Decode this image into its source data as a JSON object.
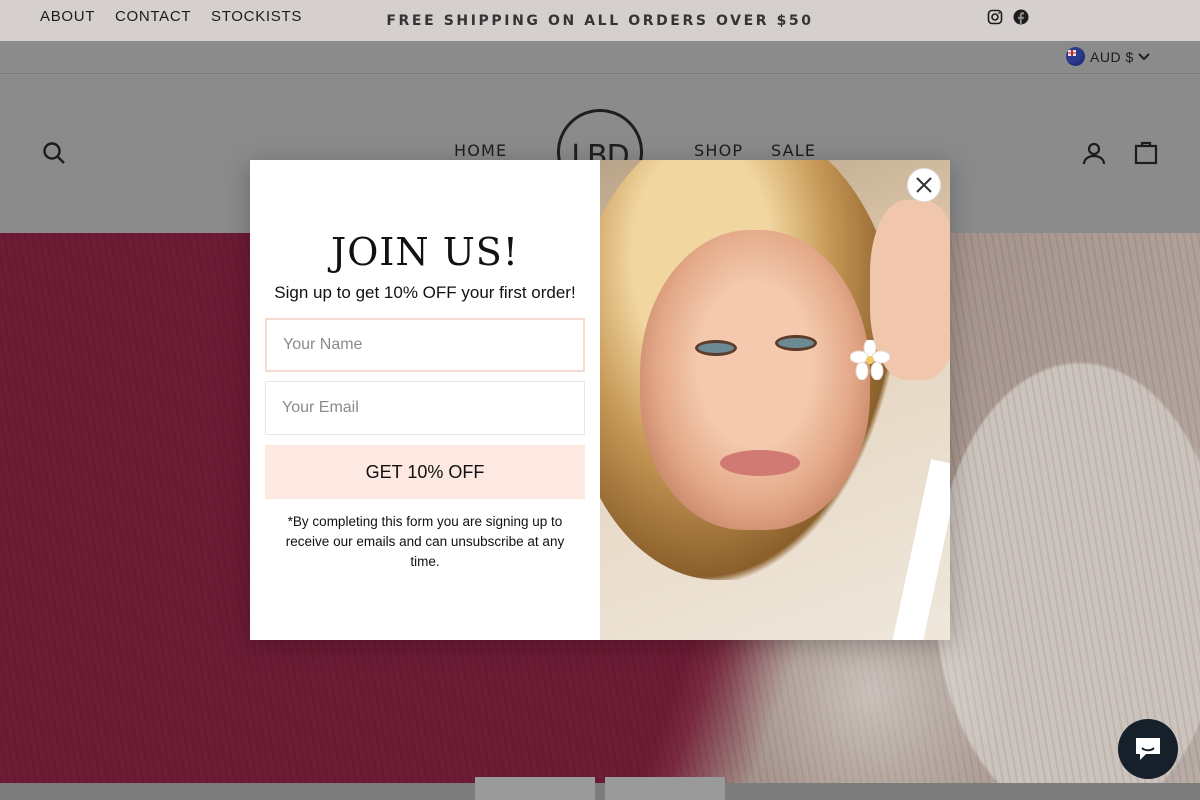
{
  "announcement": {
    "text": "FREE SHIPPING ON ALL ORDERS OVER $50"
  },
  "utility_nav": {
    "links": [
      "ABOUT",
      "CONTACT",
      "STOCKISTS"
    ],
    "social_icons": [
      "instagram-icon",
      "facebook-icon"
    ],
    "currency": "AUD $"
  },
  "header": {
    "logo_text": "LBD",
    "nav_left": "HOME",
    "nav_right": [
      "SHOP",
      "SALE"
    ],
    "icons": [
      "search-icon",
      "account-icon",
      "cart-icon"
    ]
  },
  "modal": {
    "title": "JOIN US!",
    "subtitle": "Sign up to get 10% OFF your first order!",
    "name_placeholder": "Your Name",
    "email_placeholder": "Your Email",
    "cta_label": "GET 10% OFF",
    "disclaimer": "*By completing this form you are signing up to receive our emails and can unsubscribe at any time."
  },
  "colors": {
    "cta_bg": "#fde9e2",
    "input_focus_border": "#f5dcd2",
    "chat_bg": "#15202b"
  }
}
